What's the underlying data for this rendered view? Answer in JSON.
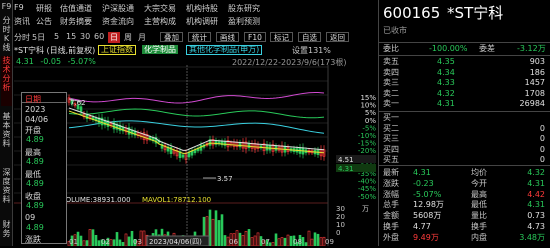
{
  "sidebar": {
    "items": [
      "F9",
      "分时",
      "K线",
      "画线",
      "",
      "技术分析",
      "",
      "基本资料",
      "",
      "深度资料",
      "",
      "财务",
      "",
      "关联"
    ]
  },
  "topnav": {
    "row1": [
      "F9",
      "研报",
      "估值通道",
      "沪深股通",
      "大宗交易",
      "机构持股",
      "股东研究"
    ],
    "row2": [
      "资讯",
      "公告",
      "财务摘要",
      "资金流向",
      "主营构成",
      "机构调研",
      "盈利预测"
    ]
  },
  "toolbar": {
    "period": [
      "分时",
      "5日",
      "5",
      "15",
      "30",
      "60",
      "日",
      "周",
      "月"
    ],
    "active_period": "日",
    "ops": [
      "叠加",
      "统计",
      "画线",
      "F10",
      "标记",
      "自选",
      "返回"
    ]
  },
  "toolbar2": {
    "items": [
      "复权",
      "叠加股",
      "指标",
      "成交",
      "鼠标悬停显示",
      "加数据"
    ]
  },
  "legend": {
    "title": "*ST宁科 (日线,前复权)",
    "tags": [
      "上证指数",
      "化学制品",
      "其他化学制品(申万)"
    ],
    "setting": "设置131%",
    "price": "4.31",
    "change": "-0.05",
    "pct": "-5.07%",
    "range": "2022/12/22-2023/9/6(173根)"
  },
  "toolbar_icons": [
    "▲",
    "▼",
    "⊕",
    "↺",
    "▢"
  ],
  "chart": {
    "hi_label": "7.62",
    "lo_label": "3.57",
    "pct_ticks": [
      "15%",
      "10%",
      "5%",
      "0%",
      "-5%",
      "-10%",
      "-15%",
      "-20%",
      "-25%",
      "-30%",
      "-35%",
      "-40%",
      "-45%",
      "-50%"
    ],
    "price_ticks": [
      "4.51",
      "4.31"
    ],
    "month_labels": [
      "01",
      "02",
      "03",
      "04",
      "05",
      "06",
      "07",
      "08",
      "09"
    ],
    "date_label": "2023/04/06(四)",
    "vol_label": "VOLUME:38931.000",
    "mavol_label": "MAVOL1:78712.100",
    "vol_ticks": [
      "30",
      "20",
      "10",
      "0"
    ],
    "vol_unit": "万"
  },
  "popup": {
    "title": "日期",
    "labels": [
      "日期",
      "开盘",
      "最高",
      "最低",
      "收盘",
      "涨跌"
    ],
    "values": [
      "2023",
      "04/06",
      "4.89",
      "4.89",
      "4.89",
      "4.89"
    ],
    "extra": [
      "09",
      "4.89"
    ],
    "bottom": "涨跌"
  },
  "header_right": {
    "code": "600165",
    "name": "*ST宁科",
    "status": "已收市"
  },
  "order_book": {
    "wb_label": "委比",
    "wb": "-100.00%",
    "wc_label": "委差",
    "wc": "-3.12万",
    "sells": [
      {
        "label": "卖五",
        "price": "4.35",
        "vol": "903"
      },
      {
        "label": "卖四",
        "price": "4.34",
        "vol": "186"
      },
      {
        "label": "卖三",
        "price": "4.33",
        "vol": "1457"
      },
      {
        "label": "卖二",
        "price": "4.32",
        "vol": "1708"
      },
      {
        "label": "卖一",
        "price": "4.31",
        "vol": "26984"
      }
    ],
    "buys": [
      {
        "label": "买一",
        "price": "",
        "vol": ""
      },
      {
        "label": "买二",
        "price": "",
        "vol": "0"
      },
      {
        "label": "买三",
        "price": "",
        "vol": "0"
      },
      {
        "label": "买四",
        "price": "",
        "vol": "0"
      },
      {
        "label": "买五",
        "price": "",
        "vol": "0"
      }
    ]
  },
  "quote": {
    "rows": [
      {
        "l1": "最新",
        "v1": "4.31",
        "l2": "均价",
        "v2": "4.32"
      },
      {
        "l1": "涨跌",
        "v1": "-0.23",
        "l2": "今开",
        "v2": "4.31"
      },
      {
        "l1": "涨幅",
        "v1": "-5.07%",
        "l2": "最高",
        "v2": "4.42"
      },
      {
        "l1": "总手",
        "v1": "12.98万",
        "l2": "最低",
        "v2": "4.31"
      },
      {
        "l1": "金额",
        "v1": "5608万",
        "l2": "量比",
        "v2": "0.73"
      },
      {
        "l1": "换手",
        "v1": "4.77",
        "l2": "换手",
        "v2": "4.73"
      },
      {
        "l1": "外盘",
        "v1": "9.49万",
        "l2": "内盘",
        "v2": "3.48万"
      }
    ]
  },
  "colors": {
    "red": "#ff3b3b",
    "green": "#29c95a",
    "yellow": "#e8e030",
    "cyan": "#3ad0e0",
    "magenta": "#d04ad0",
    "white": "#e0e0e0"
  }
}
